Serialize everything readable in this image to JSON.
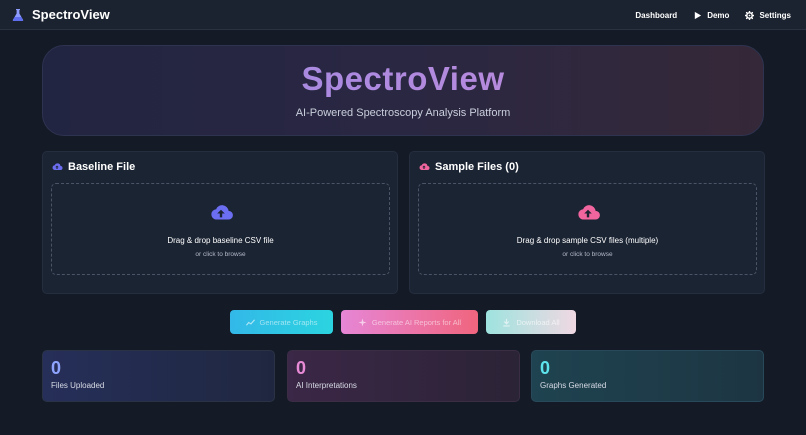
{
  "nav": {
    "brand": "SpectroView",
    "links": [
      {
        "label": "Dashboard",
        "icon": "none"
      },
      {
        "label": "Demo",
        "icon": "play-icon"
      },
      {
        "label": "Settings",
        "icon": "gear-icon"
      }
    ]
  },
  "hero": {
    "title": "SpectroView",
    "subtitle": "AI-Powered Spectroscopy Analysis Platform"
  },
  "baseline": {
    "title": "Baseline File",
    "drop_title": "Drag & drop baseline CSV file",
    "drop_hint": "or click to browse",
    "icon": "cloud-upload-icon",
    "color": "#6b6ef0"
  },
  "sample": {
    "title": "Sample Files (0)",
    "drop_title": "Drag & drop sample CSV files (multiple)",
    "drop_hint": "or click to browse",
    "icon": "cloud-upload-icon",
    "color": "#f0659e"
  },
  "actions": {
    "generate_graphs": "Generate Graphs",
    "generate_reports": "Generate AI Reports for All",
    "download_all": "Download All"
  },
  "stats": [
    {
      "value": "0",
      "label": "Files Uploaded",
      "color": "#8fa4ff"
    },
    {
      "value": "0",
      "label": "AI Interpretations",
      "color": "#e88ad6"
    },
    {
      "value": "0",
      "label": "Graphs Generated",
      "color": "#5de3ec"
    }
  ]
}
